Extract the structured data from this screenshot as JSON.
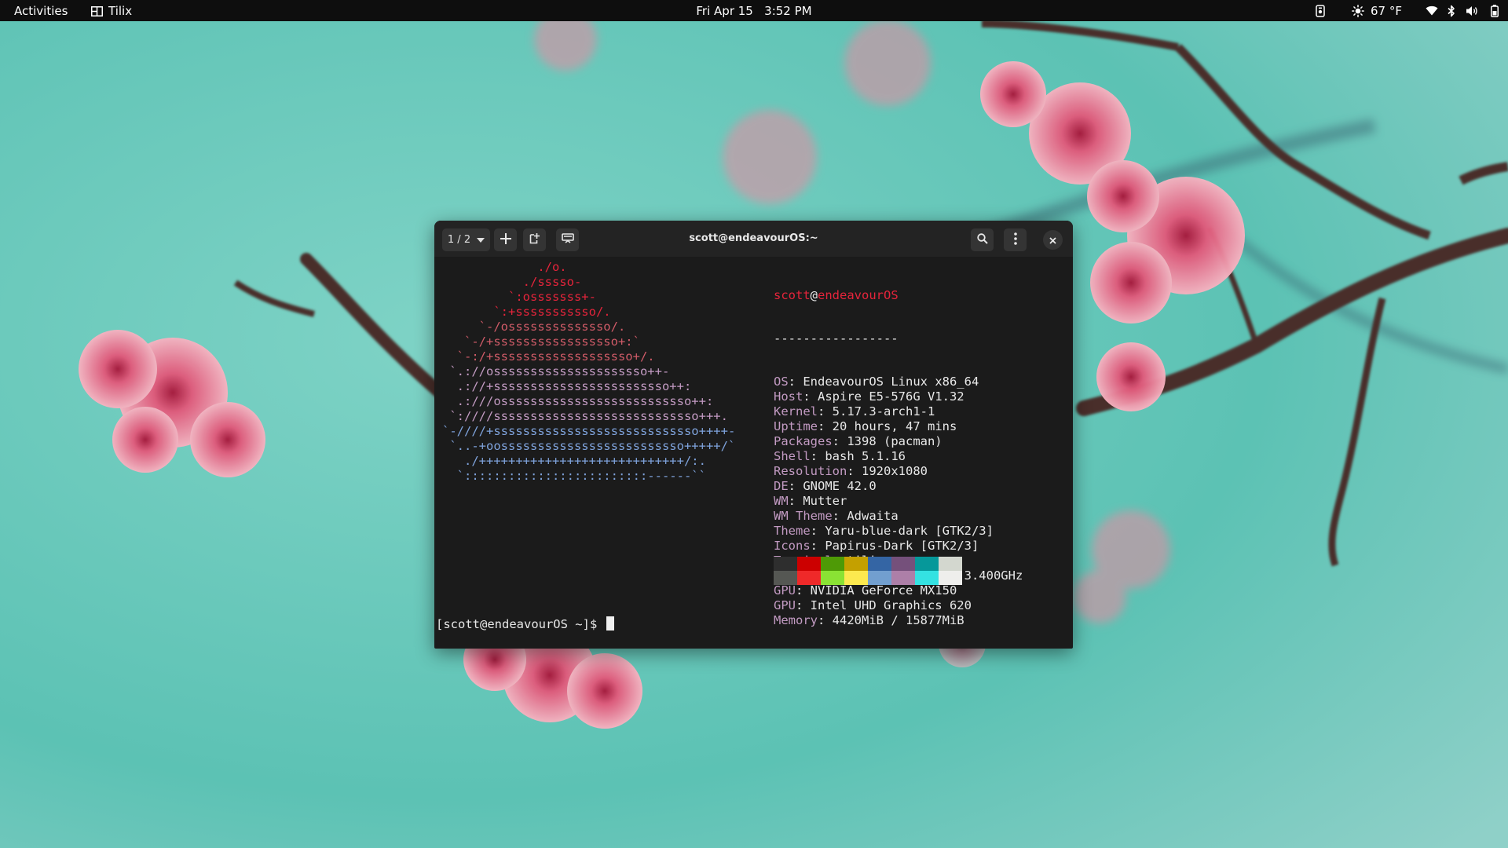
{
  "topbar": {
    "activities": "Activities",
    "app_name": "Tilix",
    "date": "Fri Apr 15",
    "time": "3:52 PM",
    "weather_temp": "67 °F",
    "icons": [
      "terminal-app-icon",
      "screen-share-icon",
      "weather-sun-icon",
      "wifi-icon",
      "bluetooth-icon",
      "volume-icon",
      "battery-icon"
    ]
  },
  "terminal": {
    "title": "scott@endeavourOS:~",
    "session_label": "1 / 2",
    "logo_lines": [
      "             ./o.",
      "           ./sssso-",
      "         `:osssssss+-",
      "       `:+sssssssssso/.",
      "     `-/ossssssssssssso/.",
      "   `-/+sssssssssssssssso+:`",
      "  `-:/+sssssssssssssssssso+/.",
      " `.://osssssssssssssssssssso++-",
      "  .://+ssssssssssssssssssssssso++:",
      "  .:///ossssssssssssssssssssssssso++:",
      " `:////ssssssssssssssssssssssssssso+++.",
      "`-////+ssssssssssssssssssssssssssso++++-",
      " `..-+oosssssssssssssssssssssssso+++++/`",
      "   ./++++++++++++++++++++++++++++/:.",
      "  `:::::::::::::::::::::::::------``"
    ],
    "logo_colors": [
      "#e5243b",
      "#d05b68",
      "#c39bc3",
      "#7fa3dc"
    ],
    "user": "scott",
    "host": "endeavourOS",
    "separator": "-----------------",
    "info": [
      {
        "key": "OS",
        "value": "EndeavourOS Linux x86_64"
      },
      {
        "key": "Host",
        "value": "Aspire E5-576G V1.32"
      },
      {
        "key": "Kernel",
        "value": "5.17.3-arch1-1"
      },
      {
        "key": "Uptime",
        "value": "20 hours, 47 mins"
      },
      {
        "key": "Packages",
        "value": "1398 (pacman)"
      },
      {
        "key": "Shell",
        "value": "bash 5.1.16"
      },
      {
        "key": "Resolution",
        "value": "1920x1080"
      },
      {
        "key": "DE",
        "value": "GNOME 42.0"
      },
      {
        "key": "WM",
        "value": "Mutter"
      },
      {
        "key": "WM Theme",
        "value": "Adwaita"
      },
      {
        "key": "Theme",
        "value": "Yaru-blue-dark [GTK2/3]"
      },
      {
        "key": "Icons",
        "value": "Papirus-Dark [GTK2/3]"
      },
      {
        "key": "Terminal",
        "value": "tilix"
      },
      {
        "key": "CPU",
        "value": "Intel i5-8250U (8) @ 3.400GHz"
      },
      {
        "key": "GPU",
        "value": "NVIDIA GeForce MX150"
      },
      {
        "key": "GPU",
        "value": "Intel UHD Graphics 620"
      },
      {
        "key": "Memory",
        "value": "4420MiB / 15877MiB"
      }
    ],
    "palette_top": [
      "#2e2e2e",
      "#cc0000",
      "#4e9a06",
      "#c4a000",
      "#3465a4",
      "#75507b",
      "#06989a",
      "#d3d7cf"
    ],
    "palette_bottom": [
      "#555753",
      "#ef2929",
      "#8ae234",
      "#fce94f",
      "#729fcf",
      "#ad7fa8",
      "#34e2e2",
      "#eeeeec"
    ],
    "prompt": "[scott@endeavourOS ~]$ "
  }
}
